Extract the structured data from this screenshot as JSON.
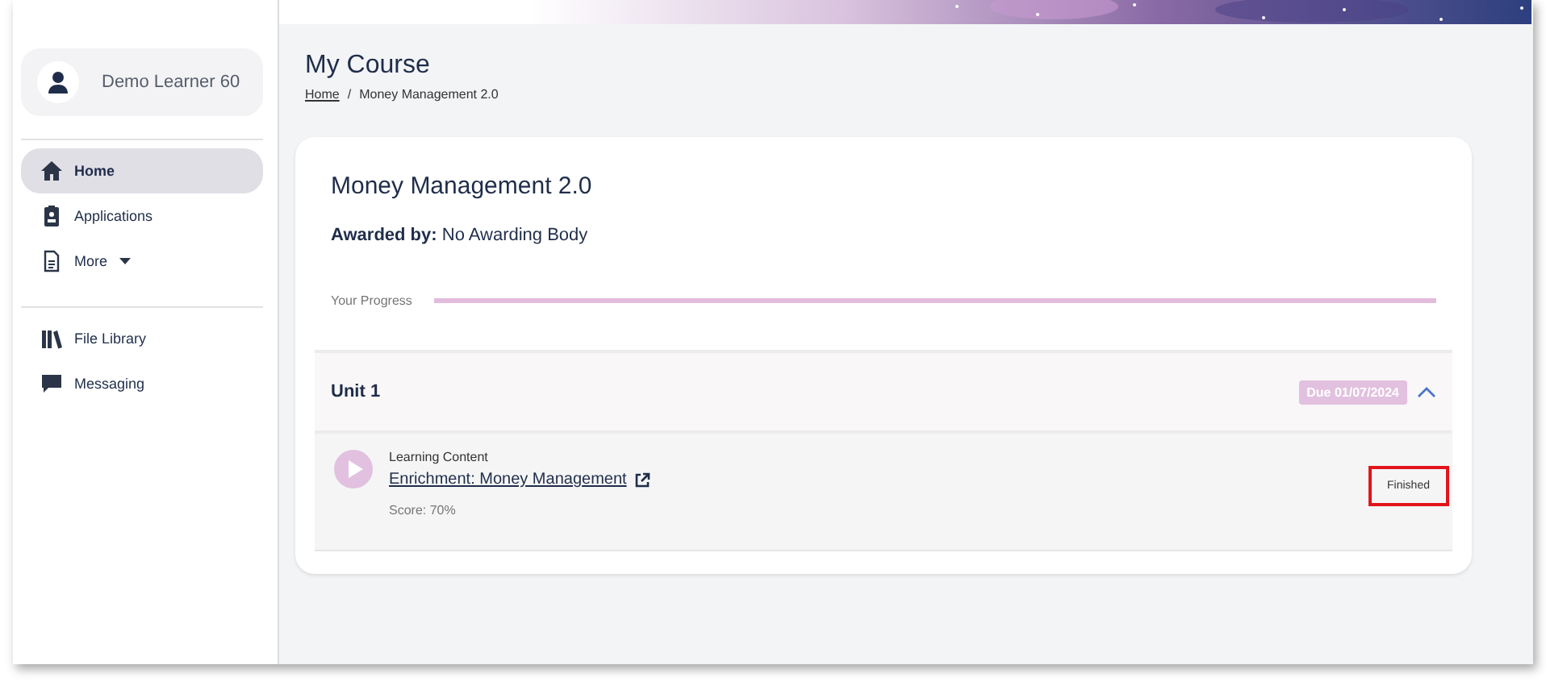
{
  "user": {
    "name": "Demo Learner 60"
  },
  "nav_groups": [
    {
      "items": [
        {
          "label": "Home",
          "selected": true
        },
        {
          "label": "Applications",
          "selected": false
        },
        {
          "label": "More",
          "selected": false,
          "dropdown": true
        }
      ]
    },
    {
      "items": [
        {
          "label": "File Library",
          "selected": false
        },
        {
          "label": "Messaging",
          "selected": false
        }
      ]
    }
  ],
  "page": {
    "title": "My Course",
    "breadcrumb": [
      {
        "label": "Home",
        "link": true
      },
      {
        "label": "/",
        "link": false
      },
      {
        "label": "Money Management 2.0",
        "link": false
      }
    ]
  },
  "course": {
    "title": "Money Management 2.0",
    "awarded_by": "**Awarded by:** No Awarding Body",
    "progress_label": "Your Progress",
    "progress": {
      "level": 1
    }
  },
  "units": [
    {
      "title": "Unit 1",
      "due": "Due 01/07/2024",
      "expanded": true,
      "items": [
        {
          "type": "Learning Content",
          "title": "Enrichment: Money Management",
          "score": "Score: 70%",
          "status": "Finished",
          "highlighted": true
        }
      ]
    }
  ]
}
